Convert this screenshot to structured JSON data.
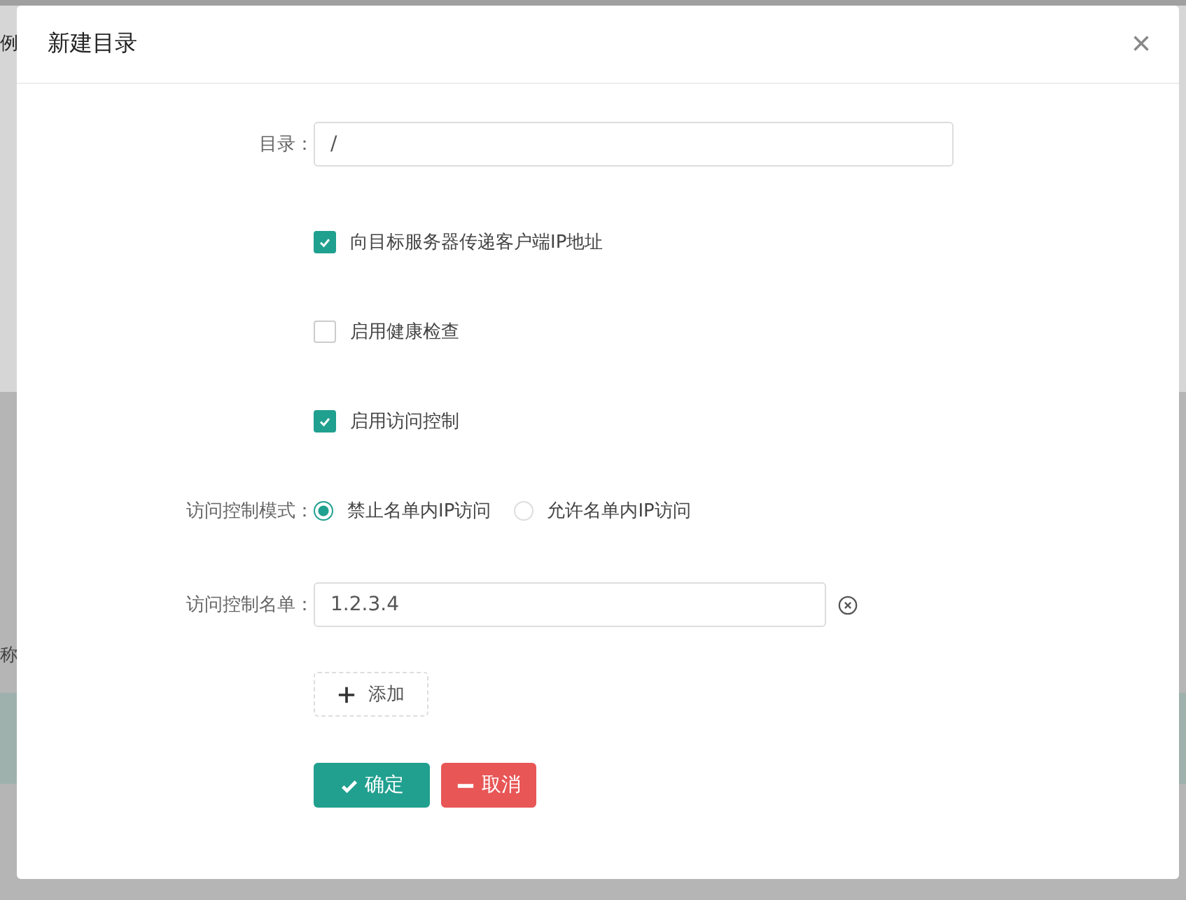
{
  "backdrop": {
    "texts": [
      "例",
      "称"
    ]
  },
  "dialog": {
    "title": "新建目录",
    "close": "×"
  },
  "form": {
    "directory": {
      "label": "目录：",
      "value": "/"
    },
    "checkboxes": [
      {
        "label": "向目标服务器传递客户端IP地址",
        "checked": true
      },
      {
        "label": "启用健康检查",
        "checked": false
      },
      {
        "label": "启用访问控制",
        "checked": true
      }
    ],
    "mode": {
      "label": "访问控制模式：",
      "options": [
        {
          "label": "禁止名单内IP访问",
          "selected": true
        },
        {
          "label": "允许名单内IP访问",
          "selected": false
        }
      ]
    },
    "list": {
      "label": "访问控制名单：",
      "entries": [
        "1.2.3.4"
      ]
    },
    "add_button": "添加",
    "buttons": [
      {
        "label": "确定",
        "kind": "confirm"
      },
      {
        "label": "取消",
        "kind": "cancel"
      }
    ]
  }
}
